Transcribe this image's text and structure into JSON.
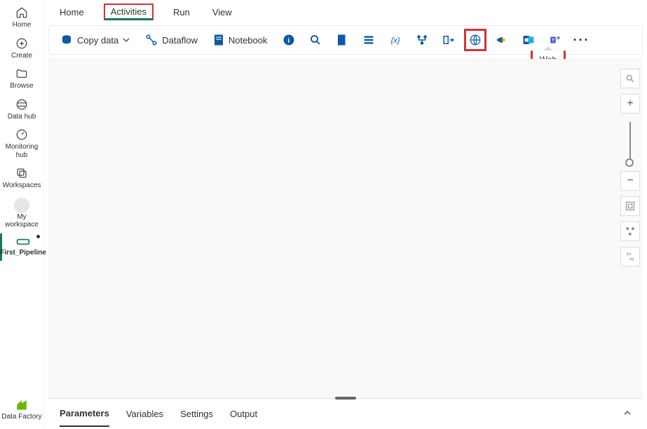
{
  "rail": {
    "home": "Home",
    "create": "Create",
    "browse": "Browse",
    "datahub": "Data hub",
    "monitoring": "Monitoring hub",
    "workspaces": "Workspaces",
    "myworkspace": "My workspace",
    "pipeline": "First_Pipeline",
    "datafactory": "Data Factory"
  },
  "menu": {
    "home": "Home",
    "activities": "Activities",
    "run": "Run",
    "view": "View"
  },
  "toolbar": {
    "copydata": "Copy data",
    "dataflow": "Dataflow",
    "notebook": "Notebook"
  },
  "tooltip": {
    "web": "Web"
  },
  "bottom": {
    "parameters": "Parameters",
    "variables": "Variables",
    "settings": "Settings",
    "output": "Output"
  },
  "colors": {
    "accent": "#0c59a4",
    "teal": "#117865",
    "red": "#d13438"
  }
}
